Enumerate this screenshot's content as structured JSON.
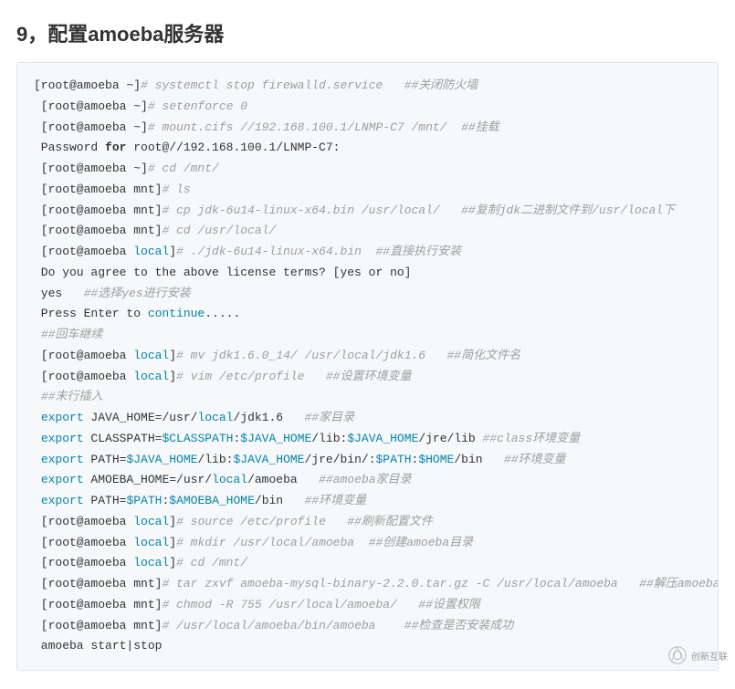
{
  "heading": "9，配置amoeba服务器",
  "watermark_text": "创新互联",
  "code": {
    "lines": [
      {
        "segs": [
          {
            "t": "[root@amoeba ~]"
          },
          {
            "t": "# systemctl stop firewalld.service   ##关闭防火墙",
            "cls": "c"
          }
        ]
      },
      {
        "segs": [
          {
            "t": " [root@amoeba ~]"
          },
          {
            "t": "# setenforce 0",
            "cls": "c"
          }
        ]
      },
      {
        "segs": [
          {
            "t": " [root@amoeba ~]"
          },
          {
            "t": "# mount.cifs //192.168.100.1/LNMP-C7 /mnt/  ##挂载",
            "cls": "c"
          }
        ]
      },
      {
        "segs": [
          {
            "t": " Password "
          },
          {
            "t": "for",
            "cls": "kw"
          },
          {
            "t": " root@//192.168.100.1/LNMP-C7:"
          }
        ]
      },
      {
        "segs": [
          {
            "t": " [root@amoeba ~]"
          },
          {
            "t": "# cd /mnt/",
            "cls": "c"
          }
        ]
      },
      {
        "segs": [
          {
            "t": " [root@amoeba mnt]"
          },
          {
            "t": "# ls",
            "cls": "c"
          }
        ]
      },
      {
        "segs": [
          {
            "t": " [root@amoeba mnt]"
          },
          {
            "t": "# cp jdk-6u14-linux-x64.bin /usr/local/   ##复制jdk二进制文件到/usr/local下",
            "cls": "c"
          }
        ]
      },
      {
        "segs": [
          {
            "t": " [root@amoeba mnt]"
          },
          {
            "t": "# cd /usr/local/",
            "cls": "c"
          }
        ]
      },
      {
        "segs": [
          {
            "t": " [root@amoeba "
          },
          {
            "t": "local",
            "cls": "bi"
          },
          {
            "t": "]"
          },
          {
            "t": "# ./jdk-6u14-linux-x64.bin  ##直接执行安装",
            "cls": "c"
          }
        ]
      },
      {
        "segs": [
          {
            "t": " Do you agree to the above license terms? [yes or no]"
          }
        ]
      },
      {
        "segs": [
          {
            "t": " yes   "
          },
          {
            "t": "##选择yes进行安装",
            "cls": "c"
          }
        ]
      },
      {
        "segs": [
          {
            "t": " Press Enter to "
          },
          {
            "t": "continue",
            "cls": "bi"
          },
          {
            "t": "....."
          }
        ]
      },
      {
        "segs": [
          {
            "t": " "
          },
          {
            "t": "##回车继续",
            "cls": "c"
          }
        ]
      },
      {
        "segs": [
          {
            "t": " [root@amoeba "
          },
          {
            "t": "local",
            "cls": "bi"
          },
          {
            "t": "]"
          },
          {
            "t": "# mv jdk1.6.0_14/ /usr/local/jdk1.6   ##简化文件名",
            "cls": "c"
          }
        ]
      },
      {
        "segs": [
          {
            "t": " [root@amoeba "
          },
          {
            "t": "local",
            "cls": "bi"
          },
          {
            "t": "]"
          },
          {
            "t": "# vim /etc/profile   ##设置环境变量",
            "cls": "c"
          }
        ]
      },
      {
        "segs": [
          {
            "t": " "
          },
          {
            "t": "##末行插入",
            "cls": "c"
          }
        ]
      },
      {
        "segs": [
          {
            "t": " "
          },
          {
            "t": "export",
            "cls": "bi"
          },
          {
            "t": " JAVA_HOME=/usr/"
          },
          {
            "t": "local",
            "cls": "bi"
          },
          {
            "t": "/jdk1.6   "
          },
          {
            "t": "##家目录",
            "cls": "c"
          }
        ]
      },
      {
        "segs": [
          {
            "t": " "
          },
          {
            "t": "export",
            "cls": "bi"
          },
          {
            "t": " CLASSPATH="
          },
          {
            "t": "$CLASSPATH",
            "cls": "bi"
          },
          {
            "t": ":"
          },
          {
            "t": "$JAVA_HOME",
            "cls": "bi"
          },
          {
            "t": "/lib:"
          },
          {
            "t": "$JAVA_HOME",
            "cls": "bi"
          },
          {
            "t": "/jre/lib "
          },
          {
            "t": "##class环境变量",
            "cls": "c"
          }
        ]
      },
      {
        "segs": [
          {
            "t": " "
          },
          {
            "t": "export",
            "cls": "bi"
          },
          {
            "t": " PATH="
          },
          {
            "t": "$JAVA_HOME",
            "cls": "bi"
          },
          {
            "t": "/lib:"
          },
          {
            "t": "$JAVA_HOME",
            "cls": "bi"
          },
          {
            "t": "/jre/bin/:"
          },
          {
            "t": "$PATH",
            "cls": "bi"
          },
          {
            "t": ":"
          },
          {
            "t": "$HOME",
            "cls": "bi"
          },
          {
            "t": "/bin   "
          },
          {
            "t": "##环境变量",
            "cls": "c"
          }
        ]
      },
      {
        "segs": [
          {
            "t": " "
          },
          {
            "t": "export",
            "cls": "bi"
          },
          {
            "t": " AMOEBA_HOME=/usr/"
          },
          {
            "t": "local",
            "cls": "bi"
          },
          {
            "t": "/amoeba   "
          },
          {
            "t": "##amoeba家目录",
            "cls": "c"
          }
        ]
      },
      {
        "segs": [
          {
            "t": " "
          },
          {
            "t": "export",
            "cls": "bi"
          },
          {
            "t": " PATH="
          },
          {
            "t": "$PATH",
            "cls": "bi"
          },
          {
            "t": ":"
          },
          {
            "t": "$AMOEBA_HOME",
            "cls": "bi"
          },
          {
            "t": "/bin   "
          },
          {
            "t": "##环境变量",
            "cls": "c"
          }
        ]
      },
      {
        "segs": [
          {
            "t": " [root@amoeba "
          },
          {
            "t": "local",
            "cls": "bi"
          },
          {
            "t": "]"
          },
          {
            "t": "# source /etc/profile   ##刷新配置文件",
            "cls": "c"
          }
        ]
      },
      {
        "segs": [
          {
            "t": " [root@amoeba "
          },
          {
            "t": "local",
            "cls": "bi"
          },
          {
            "t": "]"
          },
          {
            "t": "# mkdir /usr/local/amoeba  ##创建amoeba目录",
            "cls": "c"
          }
        ]
      },
      {
        "segs": [
          {
            "t": " [root@amoeba "
          },
          {
            "t": "local",
            "cls": "bi"
          },
          {
            "t": "]"
          },
          {
            "t": "# cd /mnt/",
            "cls": "c"
          }
        ]
      },
      {
        "segs": [
          {
            "t": " [root@amoeba mnt]"
          },
          {
            "t": "# tar zxvf amoeba-mysql-binary-2.2.0.tar.gz -C /usr/local/amoeba   ##解压amoeba",
            "cls": "c"
          }
        ]
      },
      {
        "segs": [
          {
            "t": " [root@amoeba mnt]"
          },
          {
            "t": "# chmod -R 755 /usr/local/amoeba/   ##设置权限",
            "cls": "c"
          }
        ]
      },
      {
        "segs": [
          {
            "t": " [root@amoeba mnt]"
          },
          {
            "t": "# /usr/local/amoeba/bin/amoeba    ##检查是否安装成功",
            "cls": "c"
          }
        ]
      },
      {
        "segs": [
          {
            "t": " amoeba start|stop"
          }
        ]
      }
    ]
  }
}
